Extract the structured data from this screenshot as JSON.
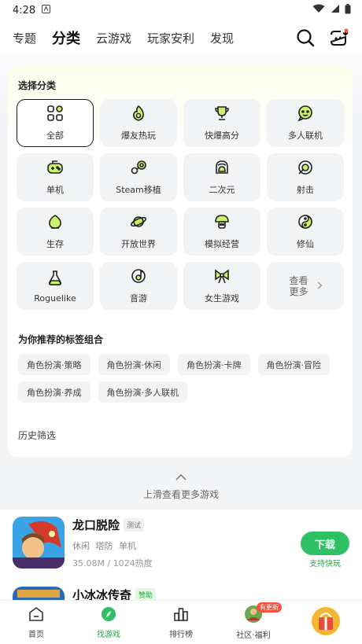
{
  "status_bar": {
    "time": "4:28"
  },
  "top_nav": {
    "tabs": [
      {
        "label": "专题"
      },
      {
        "label": "分类"
      },
      {
        "label": "云游戏"
      },
      {
        "label": "玩家安利"
      },
      {
        "label": "发现"
      }
    ],
    "active_tab": "分类"
  },
  "category_section": {
    "title": "选择分类",
    "items": [
      {
        "label": "全部",
        "icon": "grid-icon"
      },
      {
        "label": "爆友热玩",
        "icon": "fire-icon"
      },
      {
        "label": "快爆高分",
        "icon": "trophy-icon"
      },
      {
        "label": "多人联机",
        "icon": "chat-icon"
      },
      {
        "label": "单机",
        "icon": "gamepad-icon"
      },
      {
        "label": "Steam移植",
        "icon": "steam-icon"
      },
      {
        "label": "二次元",
        "icon": "anime-icon"
      },
      {
        "label": "射击",
        "icon": "target-icon"
      },
      {
        "label": "生存",
        "icon": "leaf-icon"
      },
      {
        "label": "开放世界",
        "icon": "planet-icon"
      },
      {
        "label": "模拟经营",
        "icon": "mushroom-icon"
      },
      {
        "label": "修仙",
        "icon": "yinyang-icon"
      },
      {
        "label": "Roguelike",
        "icon": "potion-icon"
      },
      {
        "label": "音游",
        "icon": "music-icon"
      },
      {
        "label": "女生游戏",
        "icon": "bow-icon"
      }
    ],
    "more_label": "查看更多"
  },
  "recommended_tags": {
    "title": "为你推荐的标签组合",
    "tags": [
      "角色扮演·策略",
      "角色扮演·休闲",
      "角色扮演·卡牌",
      "角色扮演·冒险",
      "角色扮演·养成",
      "角色扮演·多人联机"
    ]
  },
  "history": {
    "title": "历史筛选"
  },
  "swipe_hint": "上滑查看更多游戏",
  "games": [
    {
      "name": "龙口脱险",
      "badge": "测试",
      "tags": "休闲 塔防 单机",
      "size": "35.08M",
      "heat": "1024热度",
      "download_label": "下载",
      "download_sub": "支持快玩"
    },
    {
      "name": "小冰冰传奇",
      "badge": "赞助"
    }
  ],
  "bottom_nav": {
    "items": [
      {
        "label": "首页",
        "icon": "home-icon"
      },
      {
        "label": "找游戏",
        "icon": "compass-icon"
      },
      {
        "label": "排行榜",
        "icon": "chart-icon"
      },
      {
        "label": "社区·福利",
        "icon": "avatar-icon",
        "badge": "有更新"
      },
      {
        "label": "",
        "icon": "gift-icon"
      }
    ]
  },
  "colors": {
    "accent_green": "#2ec065",
    "tab_highlight": "#c9f06b",
    "badge_red": "#f5533d"
  }
}
